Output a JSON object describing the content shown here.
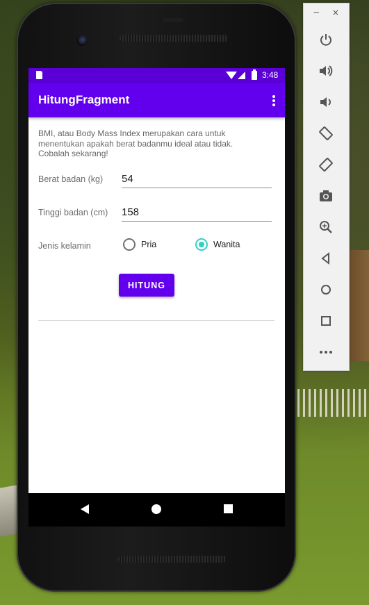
{
  "status_bar": {
    "time": "3:48"
  },
  "app_bar": {
    "title": "HitungFragment",
    "overflow_icon": "more-vert-icon"
  },
  "form": {
    "description": "BMI, atau Body Mass Index merupakan cara untuk menentukan apakah berat badanmu ideal atau tidak. Cobalah sekarang!",
    "weight_label": "Berat badan (kg)",
    "weight_value": "54",
    "height_label": "Tinggi badan (cm)",
    "height_value": "158",
    "gender_label": "Jenis kelamin",
    "gender_options": [
      "Pria",
      "Wanita"
    ],
    "gender_selected": "Wanita",
    "submit_label": "HITUNG"
  },
  "nav_bar": {
    "icons": [
      "back-icon",
      "home-icon",
      "recents-icon"
    ]
  },
  "emulator_panel": {
    "window_controls": [
      "−",
      "×"
    ],
    "buttons": [
      "power-icon",
      "volume-up-icon",
      "volume-down-icon",
      "rotate-left-icon",
      "rotate-right-icon",
      "camera-icon",
      "zoom-icon",
      "back-icon",
      "home-icon",
      "overview-icon",
      "more-icon"
    ]
  },
  "colors": {
    "primary": "#6200ee",
    "status_bar": "#5a00d6",
    "accent": "#2fd1c5"
  }
}
